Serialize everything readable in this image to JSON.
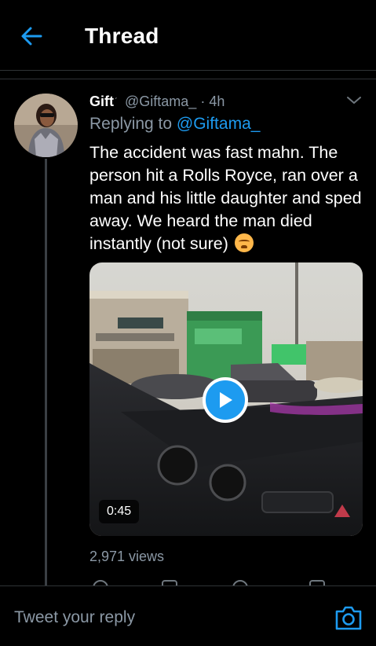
{
  "header": {
    "title": "Thread",
    "back_icon": "arrow-left-icon"
  },
  "tweet": {
    "name": "Gift",
    "badge": "́",
    "handle": "@Giftama_",
    "separator": "·",
    "time": "4h",
    "replying_prefix": "Replying to",
    "replying_to": "@Giftama_",
    "text": "The accident was fast mahn. The person hit a Rolls Royce, ran over a man and his little daughter and sped away. We heard the man died instantly (not sure)",
    "emoji": "hot-face-emoji",
    "video": {
      "duration": "0:45",
      "play_icon": "play-icon"
    },
    "views": "2,971 views"
  },
  "reply_bar": {
    "placeholder": "Tweet your reply",
    "camera_icon": "camera-icon"
  },
  "colors": {
    "accent": "#1d9bf0",
    "background": "#000000",
    "muted_text": "#8b98a5",
    "divider": "#2f3336"
  }
}
